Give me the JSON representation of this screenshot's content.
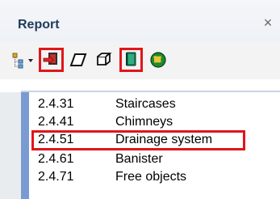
{
  "panel": {
    "title": "Report",
    "close_symbol": "×"
  },
  "toolbar": {
    "items": [
      {
        "icon": "tree-structure-dropdown-icon",
        "highlighted": false
      },
      {
        "icon": "export-report-icon",
        "highlighted": true
      },
      {
        "icon": "polygon-shape-icon",
        "highlighted": false
      },
      {
        "icon": "3d-box-icon",
        "highlighted": false
      },
      {
        "icon": "book-icon",
        "highlighted": true
      },
      {
        "icon": "globe-icon",
        "highlighted": false
      }
    ]
  },
  "list": {
    "items": [
      {
        "code": "2.4.31",
        "name": "Staircases",
        "selected": false
      },
      {
        "code": "2.4.41",
        "name": "Chimneys",
        "selected": false
      },
      {
        "code": "2.4.51",
        "name": "Drainage system",
        "selected": true
      },
      {
        "code": "2.4.61",
        "name": "Banister",
        "selected": false
      },
      {
        "code": "2.4.71",
        "name": "Free objects",
        "selected": false
      }
    ]
  },
  "colors": {
    "highlight": "#e0161a",
    "title_text": "#1f3b5a",
    "side_bar": "#7a9bd1"
  }
}
